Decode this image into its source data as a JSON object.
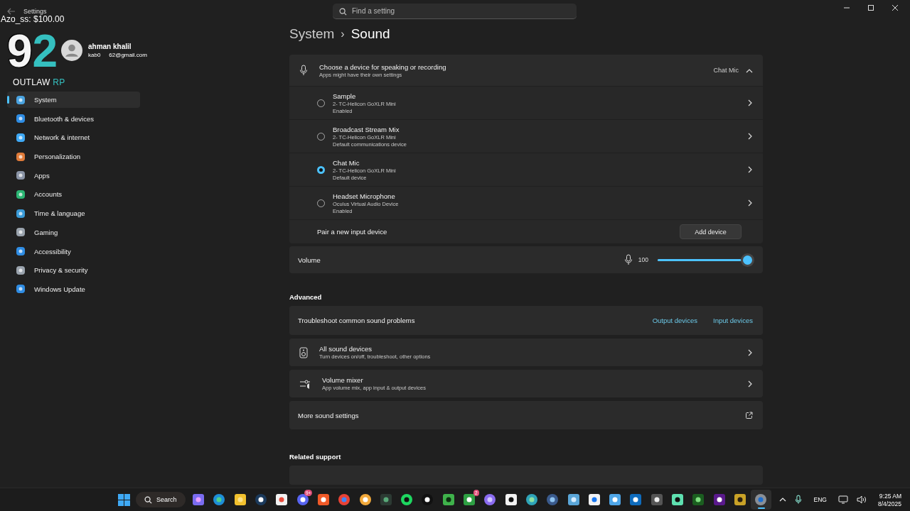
{
  "window": {
    "title": "Settings",
    "search_placeholder": "Find a setting"
  },
  "overlay": {
    "tip": "Azo_ss: $100.00",
    "digits": "92",
    "name": "OUTLAW",
    "suffix": "RP"
  },
  "profile": {
    "name_visible": "ahman khalil",
    "email_start": "kab0",
    "email_end": "62@gmail.com"
  },
  "sidebar": {
    "items": [
      {
        "label": "System",
        "kind": "system",
        "selected": true
      },
      {
        "label": "Bluetooth & devices",
        "kind": "bluetooth",
        "selected": false
      },
      {
        "label": "Network & internet",
        "kind": "network",
        "selected": false
      },
      {
        "label": "Personalization",
        "kind": "brush",
        "selected": false
      },
      {
        "label": "Apps",
        "kind": "apps",
        "selected": false
      },
      {
        "label": "Accounts",
        "kind": "accounts",
        "selected": false
      },
      {
        "label": "Time & language",
        "kind": "time",
        "selected": false
      },
      {
        "label": "Gaming",
        "kind": "gaming",
        "selected": false
      },
      {
        "label": "Accessibility",
        "kind": "accessibility",
        "selected": false
      },
      {
        "label": "Privacy & security",
        "kind": "shield",
        "selected": false
      },
      {
        "label": "Windows Update",
        "kind": "update",
        "selected": false
      }
    ]
  },
  "breadcrumb": {
    "parent": "System",
    "separator": "›",
    "current": "Sound"
  },
  "input": {
    "title": "Choose a device for speaking or recording",
    "subtitle": "Apps might have their own settings",
    "current": "Chat Mic",
    "expanded": true,
    "devices": [
      {
        "name": "Sample",
        "device": "2- TC-Helicon GoXLR Mini",
        "status": "Enabled",
        "selected": false
      },
      {
        "name": "Broadcast Stream Mix",
        "device": "2- TC-Helicon GoXLR Mini",
        "status": "Default communications device",
        "selected": false
      },
      {
        "name": "Chat Mic",
        "device": "2- TC-Helicon GoXLR Mini",
        "status": "Default device",
        "selected": true
      },
      {
        "name": "Headset Microphone",
        "device": "Oculus Virtual Audio Device",
        "status": "Enabled",
        "selected": false
      }
    ],
    "pair_label": "Pair a new input device",
    "pair_button": "Add device"
  },
  "volume": {
    "label": "Volume",
    "reading": "100",
    "level": 1.0
  },
  "advanced": {
    "heading": "Advanced",
    "troubleshoot": "Troubleshoot common sound problems",
    "links": [
      "Output devices",
      "Input devices"
    ],
    "rows": [
      {
        "kind": "speaker",
        "title": "All sound devices",
        "subtitle": "Turn devices on/off, troubleshoot, other options"
      },
      {
        "kind": "mixer",
        "title": "Volume mixer",
        "subtitle": "App volume mix, app input & output devices"
      },
      {
        "kind": "external",
        "title": "More sound settings"
      }
    ]
  },
  "related": {
    "heading": "Related support"
  },
  "taskbar": {
    "search": "Search",
    "apps": [
      {
        "kind": "copilot",
        "active": false
      },
      {
        "kind": "edge",
        "active": false
      },
      {
        "kind": "folder",
        "active": false
      },
      {
        "kind": "steam",
        "active": false
      },
      {
        "kind": "store",
        "active": false
      },
      {
        "kind": "discord",
        "badge": "9+",
        "active": false
      },
      {
        "kind": "brave",
        "active": false
      },
      {
        "kind": "chrome",
        "active": false
      },
      {
        "kind": "yellow",
        "active": false
      },
      {
        "kind": "box",
        "active": false
      },
      {
        "kind": "spotify",
        "active": false
      },
      {
        "kind": "ring",
        "active": false
      },
      {
        "kind": "creeper",
        "active": false
      },
      {
        "kind": "xbox",
        "badge": "2",
        "active": false
      },
      {
        "kind": "gamepad",
        "active": false
      },
      {
        "kind": "dark",
        "active": false
      },
      {
        "kind": "globe",
        "active": false
      },
      {
        "kind": "orb",
        "active": false
      },
      {
        "kind": "wolf",
        "active": false
      },
      {
        "kind": "meta",
        "active": false
      },
      {
        "kind": "mblue",
        "active": false
      },
      {
        "kind": "outlook",
        "active": false
      },
      {
        "kind": "bm",
        "active": false
      },
      {
        "kind": "chat",
        "active": false
      },
      {
        "kind": "nb",
        "active": false
      },
      {
        "kind": "nzxt",
        "active": false
      },
      {
        "kind": "gold",
        "active": false
      },
      {
        "kind": "gear",
        "active": true
      }
    ],
    "language": "ENG",
    "time": "9:25 AM",
    "date": "8/4/2025"
  }
}
